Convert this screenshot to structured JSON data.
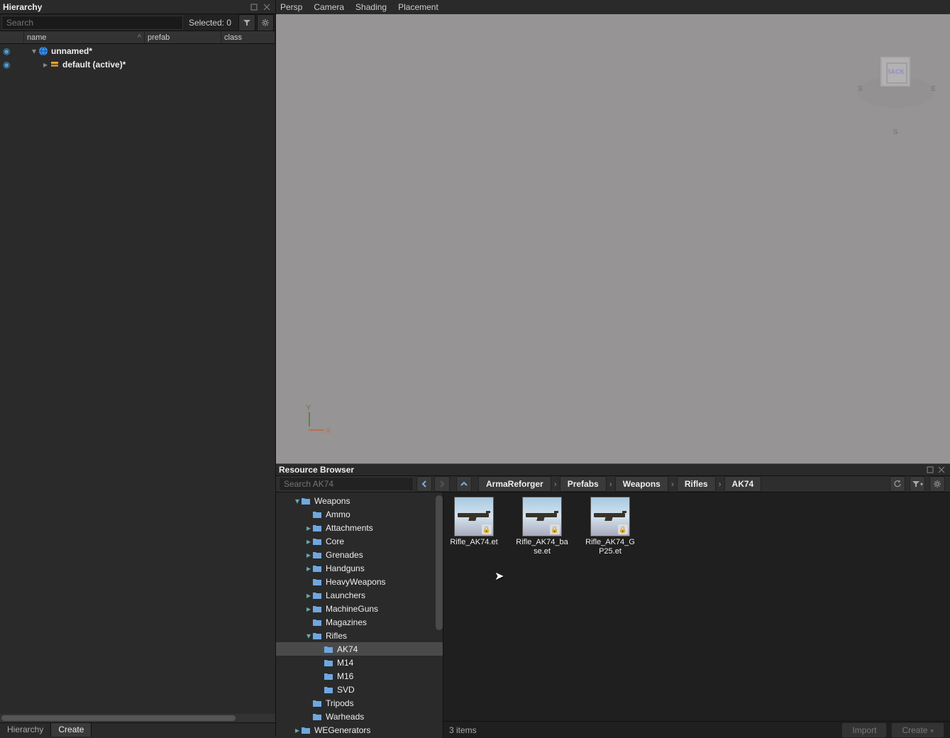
{
  "hierarchy": {
    "title": "Hierarchy",
    "search_placeholder": "Search",
    "selected_label": "Selected: 0",
    "columns": {
      "name": "name",
      "prefab": "prefab",
      "class": "class"
    },
    "items": [
      {
        "label": "unnamed*",
        "icon": "globe",
        "depth": 0,
        "expanded": true
      },
      {
        "label": "default (active)*",
        "icon": "cube",
        "depth": 1,
        "expanded": false,
        "has_children": true
      }
    ],
    "bottom_tabs": {
      "hierarchy": "Hierarchy",
      "create": "Create"
    }
  },
  "viewport": {
    "menu": [
      "Persp",
      "Camera",
      "Shading",
      "Placement"
    ],
    "axis_y": "Y",
    "axis_x": "X",
    "nav_back": "BACK",
    "nav_s1": "S",
    "nav_s2": "S",
    "nav_e": "E"
  },
  "resource_browser": {
    "title": "Resource Browser",
    "search_placeholder": "Search AK74",
    "breadcrumb": [
      "ArmaReforger",
      "Prefabs",
      "Weapons",
      "Rifles",
      "AK74"
    ],
    "tree": [
      {
        "label": "Weapons",
        "depth": 0,
        "chev": "down"
      },
      {
        "label": "Ammo",
        "depth": 1,
        "chev": ""
      },
      {
        "label": "Attachments",
        "depth": 1,
        "chev": "right"
      },
      {
        "label": "Core",
        "depth": 1,
        "chev": "right"
      },
      {
        "label": "Grenades",
        "depth": 1,
        "chev": "right"
      },
      {
        "label": "Handguns",
        "depth": 1,
        "chev": "right"
      },
      {
        "label": "HeavyWeapons",
        "depth": 1,
        "chev": ""
      },
      {
        "label": "Launchers",
        "depth": 1,
        "chev": "right"
      },
      {
        "label": "MachineGuns",
        "depth": 1,
        "chev": "right"
      },
      {
        "label": "Magazines",
        "depth": 1,
        "chev": ""
      },
      {
        "label": "Rifles",
        "depth": 1,
        "chev": "down"
      },
      {
        "label": "AK74",
        "depth": 2,
        "chev": "",
        "selected": true
      },
      {
        "label": "M14",
        "depth": 2,
        "chev": ""
      },
      {
        "label": "M16",
        "depth": 2,
        "chev": ""
      },
      {
        "label": "SVD",
        "depth": 2,
        "chev": ""
      },
      {
        "label": "Tripods",
        "depth": 1,
        "chev": ""
      },
      {
        "label": "Warheads",
        "depth": 1,
        "chev": ""
      },
      {
        "label": "WEGenerators",
        "depth": 0,
        "chev": "right"
      }
    ],
    "files": [
      {
        "label": "Rifle_AK74.et"
      },
      {
        "label": "Rifle_AK74_base.et"
      },
      {
        "label": "Rifle_AK74_GP25.et"
      }
    ],
    "status_count": "3 items",
    "import_btn": "Import",
    "create_btn": "Create"
  }
}
